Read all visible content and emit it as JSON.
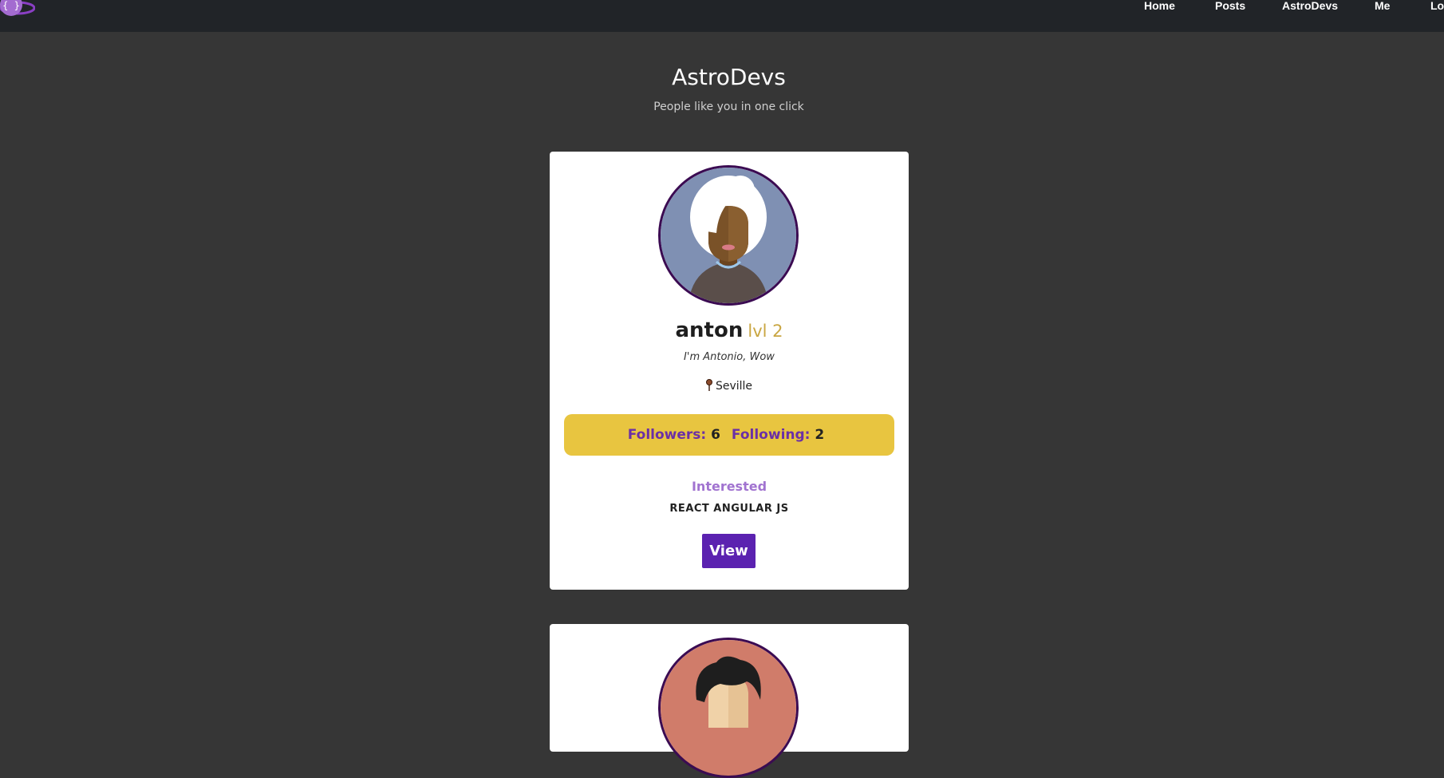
{
  "nav": {
    "logo_icon": "braces-planet-logo",
    "items": [
      {
        "label": "Home"
      },
      {
        "label": "Posts"
      },
      {
        "label": "AstroDevs"
      },
      {
        "label": "Me"
      },
      {
        "label": "Lo"
      }
    ]
  },
  "header": {
    "title": "AstroDevs",
    "subtitle": "People like you in one click"
  },
  "cards": [
    {
      "username": "anton",
      "level": "lvl 2",
      "bio": "I'm Antonio, Wow",
      "location": "Seville",
      "followers_label": "Followers:",
      "followers": "6",
      "following_label": "Following:",
      "following": "2",
      "interested_label": "Interested",
      "technologies": "REACT ANGULAR JS",
      "view_label": "View",
      "avatar_bg": "#7f90b3"
    },
    {
      "avatar_bg": "#d07c6a"
    }
  ],
  "colors": {
    "background": "#363636",
    "navbar": "#212428",
    "accent_yellow": "#e8c540",
    "accent_purple": "#5b22b0",
    "level": "#c9a642"
  }
}
